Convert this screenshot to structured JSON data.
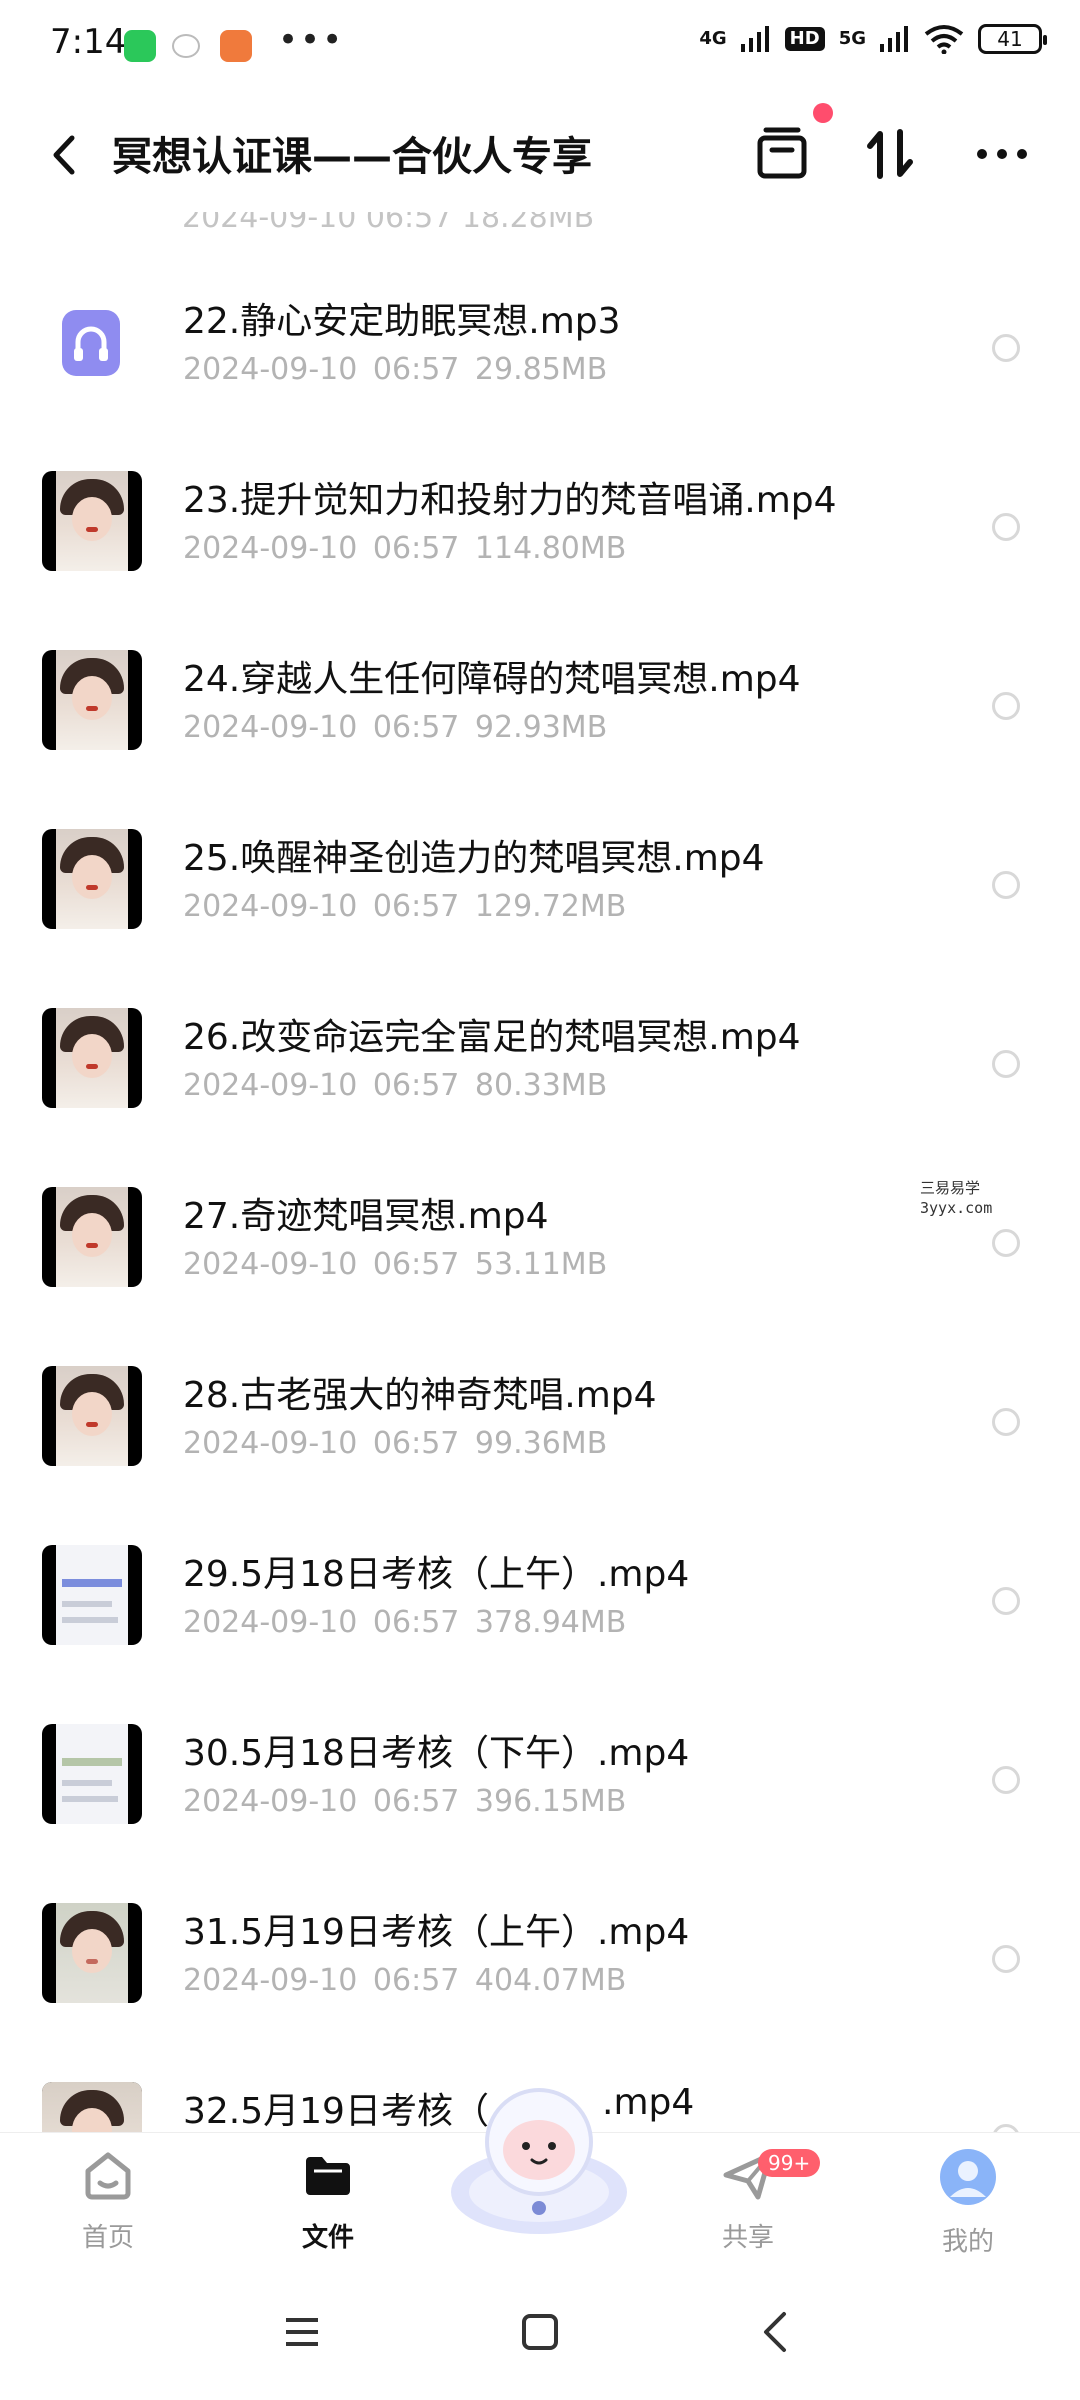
{
  "status_bar": {
    "time": "7:14",
    "more": "•••",
    "signal_1": "4G",
    "hd": "HD",
    "signal_2": "5G",
    "battery": "41"
  },
  "header": {
    "title": "冥想认证课——合伙人专享"
  },
  "partial_top_row": "2024-09-10  06:57  18.28MB",
  "files": [
    {
      "name": "22.静心安定助眠冥想.mp3",
      "date": "2024-09-10",
      "time": "06:57",
      "size": "29.85MB",
      "kind": "audio"
    },
    {
      "name": "23.提升觉知力和投射力的梵音唱诵.mp4",
      "date": "2024-09-10",
      "time": "06:57",
      "size": "114.80MB",
      "kind": "video"
    },
    {
      "name": "24.穿越人生任何障碍的梵唱冥想.mp4",
      "date": "2024-09-10",
      "time": "06:57",
      "size": "92.93MB",
      "kind": "video"
    },
    {
      "name": "25.唤醒神圣创造力的梵唱冥想.mp4",
      "date": "2024-09-10",
      "time": "06:57",
      "size": "129.72MB",
      "kind": "video"
    },
    {
      "name": "26.改变命运完全富足的梵唱冥想.mp4",
      "date": "2024-09-10",
      "time": "06:57",
      "size": "80.33MB",
      "kind": "video"
    },
    {
      "name": "27.奇迹梵唱冥想.mp4",
      "date": "2024-09-10",
      "time": "06:57",
      "size": "53.11MB",
      "kind": "video"
    },
    {
      "name": "28.古老强大的神奇梵唱.mp4",
      "date": "2024-09-10",
      "time": "06:57",
      "size": "99.36MB",
      "kind": "video"
    },
    {
      "name": "29.5月18日考核（上午）.mp4",
      "date": "2024-09-10",
      "time": "06:57",
      "size": "378.94MB",
      "kind": "screen"
    },
    {
      "name": "30.5月18日考核（下午）.mp4",
      "date": "2024-09-10",
      "time": "06:57",
      "size": "396.15MB",
      "kind": "screen"
    },
    {
      "name": "31.5月19日考核（上午）.mp4",
      "date": "2024-09-10",
      "time": "06:57",
      "size": "404.07MB",
      "kind": "video"
    },
    {
      "name": "32.5月19日考核（",
      "name_tail": ".mp4",
      "kind": "video"
    }
  ],
  "watermark": {
    "line1": "三易易学",
    "line2": "3yyx.com"
  },
  "bottom_nav": {
    "home": "首页",
    "files": "文件",
    "share": "共享",
    "share_badge": "99+",
    "me": "我的"
  },
  "colors": {
    "accent_red": "#ff4d6d",
    "meta_gray": "#b3b3b3",
    "audio_purple": "#8f8cf0"
  }
}
